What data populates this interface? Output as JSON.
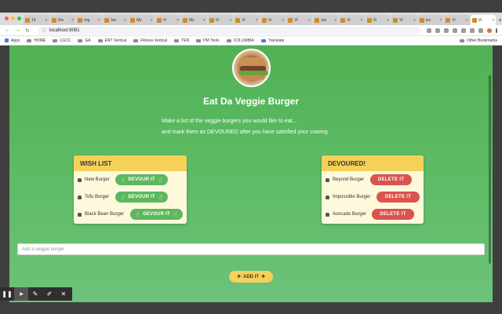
{
  "browser": {
    "tabs": [
      {
        "label": "13"
      },
      {
        "label": "Sm"
      },
      {
        "label": "reg"
      },
      {
        "label": "Jav"
      },
      {
        "label": "My"
      },
      {
        "label": "Vi"
      },
      {
        "label": "My"
      },
      {
        "label": "Vi"
      },
      {
        "label": "Vi"
      },
      {
        "label": "Vi"
      },
      {
        "label": "Vi"
      },
      {
        "label": "Jav"
      },
      {
        "label": "Vi"
      },
      {
        "label": "Vi"
      },
      {
        "label": "Vi"
      },
      {
        "label": "loc"
      },
      {
        "label": "Vi"
      },
      {
        "label": "Vi"
      }
    ],
    "url": "localhost:8081",
    "bookmarks": [
      "Apps",
      "HOME",
      "LGCC",
      "GA",
      "ENT Vertical",
      "Fitness Vertical",
      "TEN",
      "PM Tools",
      "COLUMBIA",
      "Translate"
    ],
    "other_bookmarks": "Other Bookmarks"
  },
  "page": {
    "title": "Eat Da Veggie Burger",
    "subtitle_line1": "Make a list of the veggie burgers you would like to eat...",
    "subtitle_line2": "and mark them as DEVOURED after you have satisfied your craving.",
    "wish_list": {
      "heading": "WISH LIST",
      "button_label": "DEVOUR IT",
      "items": [
        "New Burger",
        "Tofu Burger",
        "Black Bean Burger"
      ]
    },
    "devoured": {
      "heading": "DEVOURED!",
      "button_label": "DELETE IT",
      "items": [
        "Beyond Burger",
        "Impossible Burger",
        "Avocado Burger"
      ]
    },
    "input_placeholder": "Add a veggie burger",
    "add_button_label": "ADD IT"
  },
  "icons": {
    "burger": "burger-icon",
    "utensils": "utensils-icon",
    "plus": "plus-icon"
  },
  "colors": {
    "background": "#5bb85f",
    "card_header": "#f5d15a",
    "card_body": "#fff9dc",
    "devour_button": "#5cb85c",
    "delete_button": "#d9534f"
  }
}
